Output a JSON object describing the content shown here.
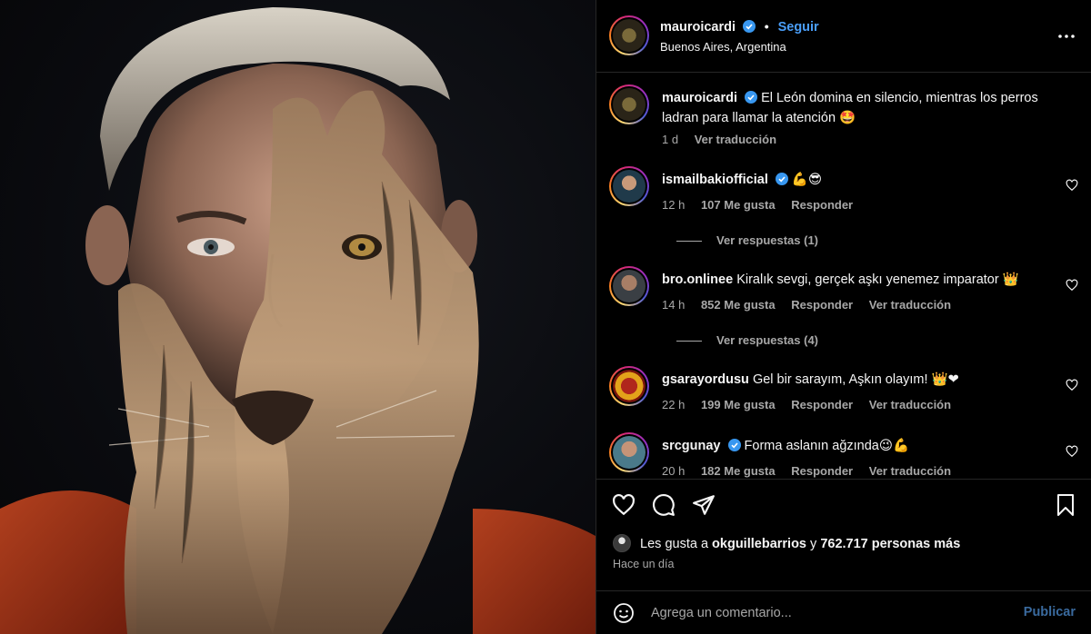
{
  "post": {
    "username": "mauroicardi",
    "follow_label": "Seguir",
    "separator": "•",
    "location": "Buenos Aires, Argentina"
  },
  "caption": {
    "username": "mauroicardi",
    "text": "El León domina en silencio, mientras los perros ladran para llamar la atención 🤩",
    "age": "1 d",
    "translate_label": "Ver traducción"
  },
  "comments": [
    {
      "username": "ismailbakiofficial",
      "verified": true,
      "text": "💪😎",
      "age": "12 h",
      "likes": "107 Me gusta",
      "reply_label": "Responder",
      "translate_label": "",
      "replies_label": "Ver respuestas (1)"
    },
    {
      "username": "bro.onlinee",
      "verified": false,
      "text": "Kiralık sevgi, gerçek aşkı yenemez imparator 👑",
      "age": "14 h",
      "likes": "852 Me gusta",
      "reply_label": "Responder",
      "translate_label": "Ver traducción",
      "replies_label": "Ver respuestas (4)"
    },
    {
      "username": "gsarayordusu",
      "verified": false,
      "text": "Gel bir sarayım, Aşkın olayım! 👑❤",
      "age": "22 h",
      "likes": "199 Me gusta",
      "reply_label": "Responder",
      "translate_label": "Ver traducción",
      "replies_label": ""
    },
    {
      "username": "srcgunay",
      "verified": true,
      "text": "Forma aslanın ağzında😉💪",
      "age": "20 h",
      "likes": "182 Me gusta",
      "reply_label": "Responder",
      "translate_label": "Ver traducción",
      "replies_label": ""
    }
  ],
  "likes": {
    "prefix": "Les gusta a",
    "user": "okguillebarrios",
    "joiner": "y",
    "others": "762.717 personas más"
  },
  "time_ago": "Hace un día",
  "add_comment": {
    "placeholder": "Agrega un comentario...",
    "publish_label": "Publicar"
  },
  "colors": {
    "accent_blue": "#4a9ef8",
    "verified_blue": "#3897f0",
    "muted_text": "#a8a8a8",
    "divider": "#262626"
  }
}
